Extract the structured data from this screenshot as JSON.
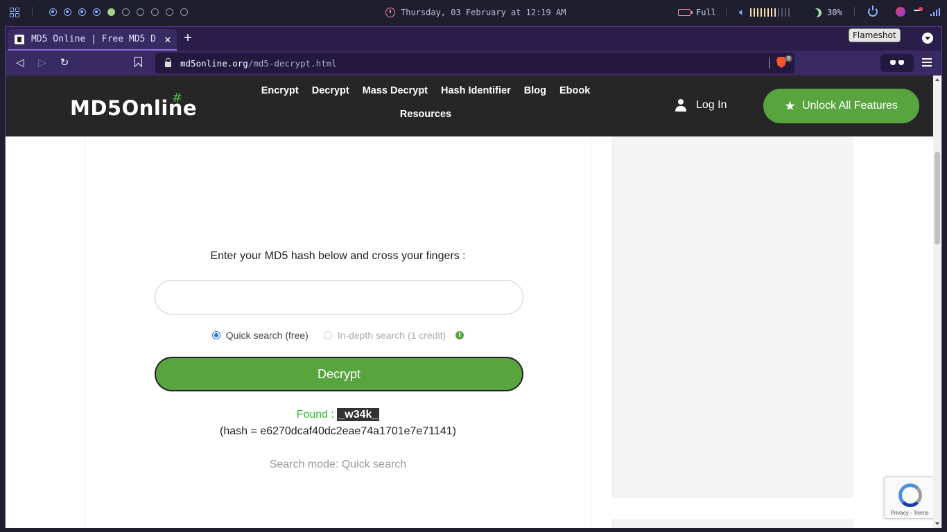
{
  "system": {
    "datetime": "Thursday, 03 February at 12:19 AM",
    "battery": "Full",
    "brightness": "30%",
    "volume_level": 0.67,
    "workspaces": [
      "active",
      "active",
      "active",
      "active",
      "current",
      "empty",
      "empty",
      "empty",
      "empty",
      "empty"
    ]
  },
  "browser": {
    "tab_title": "MD5 Online | Free MD5 D",
    "tooltip": "Flameshot",
    "url_host": "md5online.org",
    "url_path": "/md5-decrypt.html",
    "shield_count": "8",
    "icons": {
      "back": "back-icon",
      "forward": "forward-icon",
      "reload": "reload-icon",
      "bookmark": "bookmark-icon",
      "menu": "menu-icon"
    }
  },
  "site": {
    "logo_text": "MD5Online",
    "logo_hash": "#",
    "nav": [
      "Encrypt",
      "Decrypt",
      "Mass Decrypt",
      "Hash Identifier",
      "Blog",
      "Ebook",
      "Resources"
    ],
    "login_label": "Log In",
    "unlock_label": "Unlock All Features",
    "accent": "#58a53f",
    "header_bg": "#262626"
  },
  "form": {
    "prompt": "Enter your MD5 hash below and cross your fingers :",
    "input_value": "",
    "quick_label": "Quick search (free)",
    "indepth_label": "In-depth search (1 credit)",
    "decrypt_label": "Decrypt"
  },
  "result": {
    "found_label": "Found : ",
    "found_value": "_w34k_",
    "hash_line": "(hash = e6270dcaf40dc2eae74a1701e7e71141)",
    "mode_line": "Search mode: Quick search"
  },
  "recaptcha": {
    "terms": "Privacy - Terms"
  }
}
